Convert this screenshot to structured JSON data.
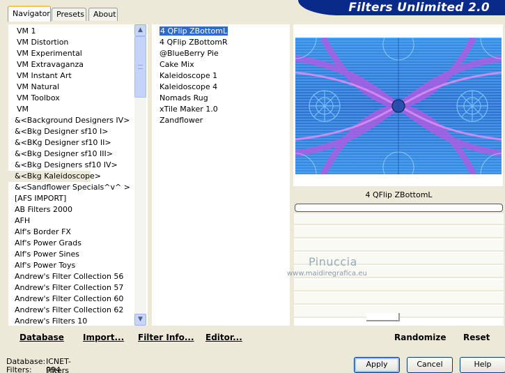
{
  "header": {
    "title": "Filters Unlimited 2.0"
  },
  "tabs": [
    {
      "label": "Navigator",
      "active": true
    },
    {
      "label": "Presets",
      "active": false
    },
    {
      "label": "About",
      "active": false
    }
  ],
  "categories": [
    "VM 1",
    "VM Distortion",
    "VM Experimental",
    "VM Extravaganza",
    "VM Instant Art",
    "VM Natural",
    "VM Toolbox",
    "VM",
    "&<Background Designers IV>",
    "&<Bkg Designer sf10 I>",
    "&<BKg Designer sf10 II>",
    "&<Bkg Designer sf10 III>",
    "&<Bkg Designers sf10 IV>",
    "&<Bkg Kaleidoscope>",
    "&<Sandflower Specials^v^ >",
    "[AFS IMPORT]",
    "AB Filters 2000",
    "AFH",
    "Alf's Border FX",
    "Alf's Power Grads",
    "Alf's Power Sines",
    "Alf's Power Toys",
    "Andrew's Filter Collection 56",
    "Andrew's Filter Collection 57",
    "Andrew's Filter Collection 60",
    "Andrew's Filter Collection 62",
    "Andrew's Filters 10"
  ],
  "selected_category": "&<Bkg Kaleidoscope>",
  "filters": [
    "4 QFlip ZBottomL",
    "4 QFlip ZBottomR",
    "@BlueBerry Pie",
    "Cake Mix",
    "Kaleidoscope 1",
    "Kaleidoscope 4",
    "Nomads Rug",
    "xTile Maker 1.0",
    "Zandflower"
  ],
  "selected_filter": "4 QFlip ZBottomL",
  "preview": {
    "effect_name": "4 QFlip ZBottomL"
  },
  "watermark": {
    "name": "Pinuccia",
    "site": "www.maidiregrafica.eu"
  },
  "toolbar": {
    "database": "Database",
    "import": "Import...",
    "filter_info": "Filter Info...",
    "editor": "Editor...",
    "randomize": "Randomize",
    "reset": "Reset"
  },
  "status": {
    "database_label": "Database:",
    "database_value": "ICNET-Filters",
    "filters_label": "Filters:",
    "filters_value": "994"
  },
  "buttons": {
    "apply": "Apply",
    "cancel": "Cancel",
    "help": "Help"
  },
  "colors": {
    "accent": "#316ac5",
    "banner": "#0a2a8a",
    "tab_highlight": "#ffc83c"
  }
}
